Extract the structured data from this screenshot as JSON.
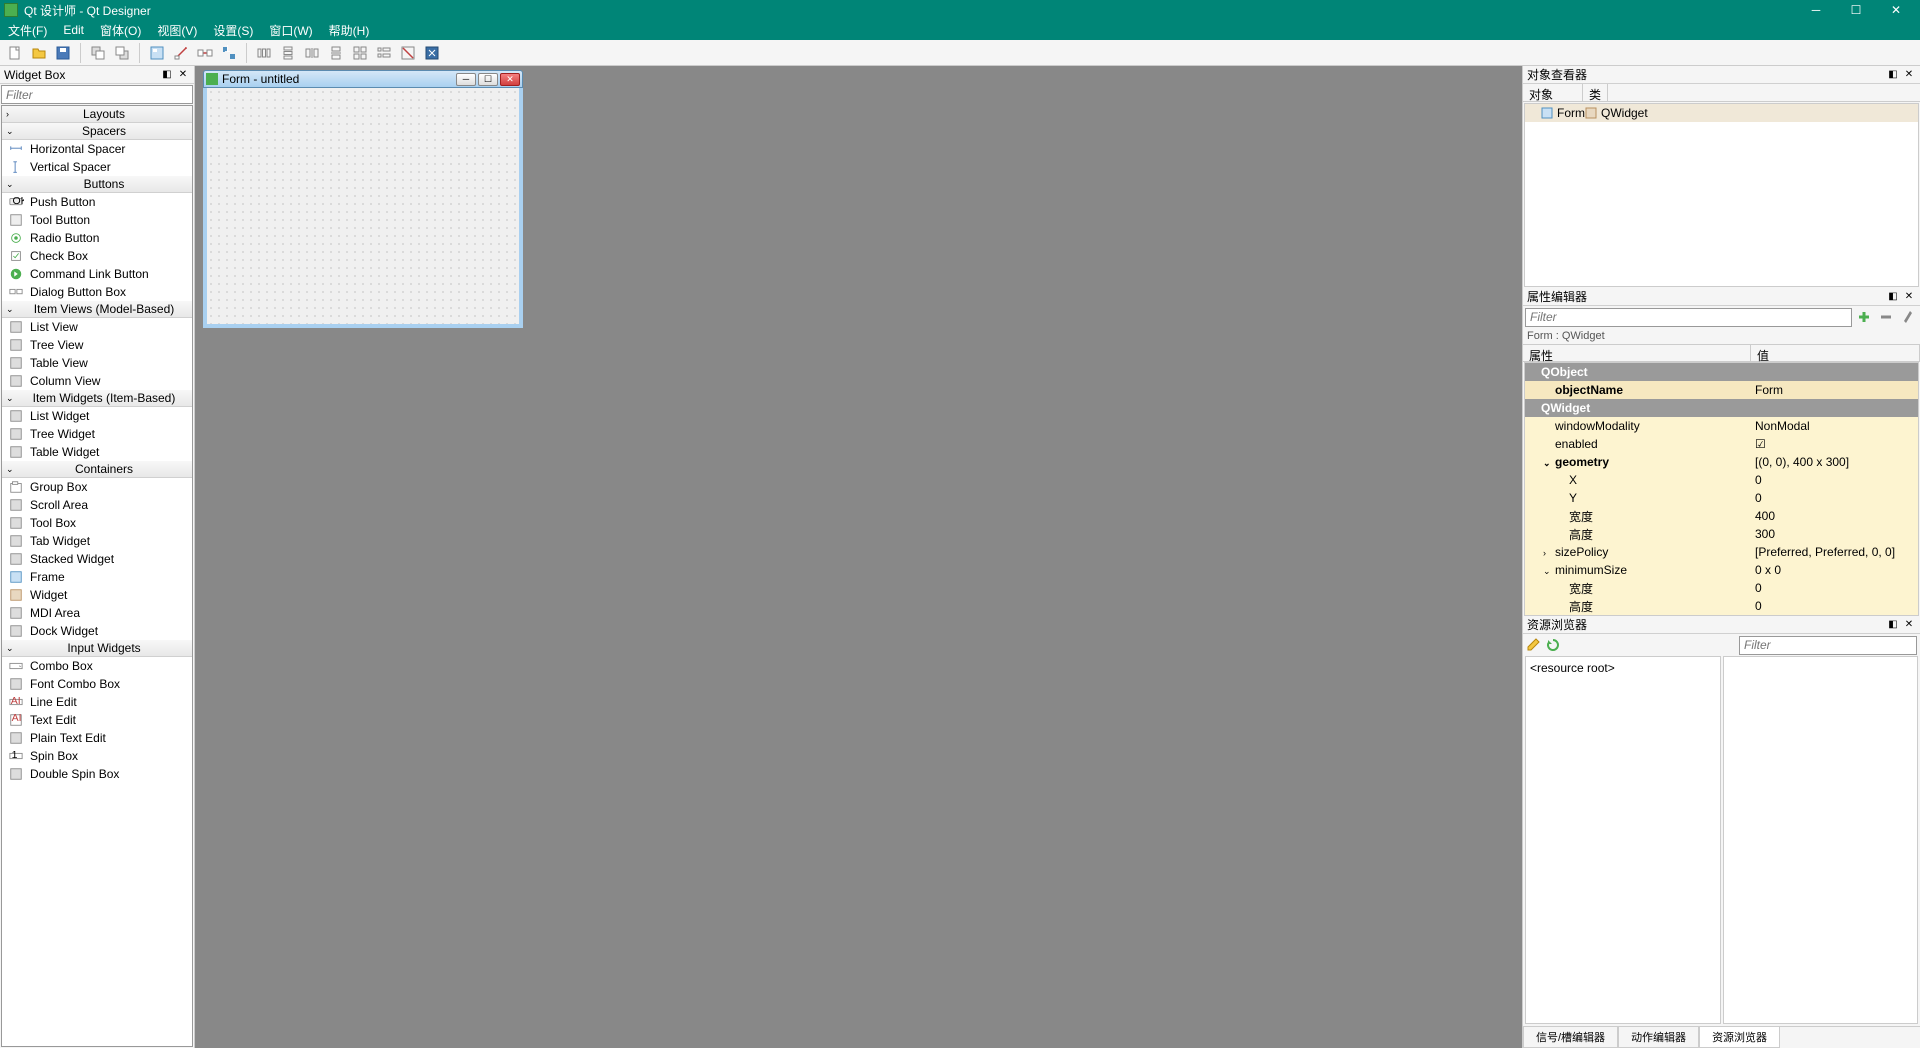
{
  "app": {
    "title": "Qt 设计师 - Qt Designer"
  },
  "menus": [
    "文件(F)",
    "Edit",
    "窗体(O)",
    "视图(V)",
    "设置(S)",
    "窗口(W)",
    "帮助(H)"
  ],
  "dock_left": {
    "title": "Widget Box",
    "filter_placeholder": "Filter"
  },
  "categories": [
    {
      "name": "Layouts",
      "open": false,
      "items": []
    },
    {
      "name": "Spacers",
      "open": true,
      "items": [
        "Horizontal Spacer",
        "Vertical Spacer"
      ]
    },
    {
      "name": "Buttons",
      "open": true,
      "items": [
        "Push Button",
        "Tool Button",
        "Radio Button",
        "Check Box",
        "Command Link Button",
        "Dialog Button Box"
      ]
    },
    {
      "name": "Item Views (Model-Based)",
      "open": true,
      "items": [
        "List View",
        "Tree View",
        "Table View",
        "Column View"
      ]
    },
    {
      "name": "Item Widgets (Item-Based)",
      "open": true,
      "items": [
        "List Widget",
        "Tree Widget",
        "Table Widget"
      ]
    },
    {
      "name": "Containers",
      "open": true,
      "items": [
        "Group Box",
        "Scroll Area",
        "Tool Box",
        "Tab Widget",
        "Stacked Widget",
        "Frame",
        "Widget",
        "MDI Area",
        "Dock Widget"
      ]
    },
    {
      "name": "Input Widgets",
      "open": true,
      "items": [
        "Combo Box",
        "Font Combo Box",
        "Line Edit",
        "Text Edit",
        "Plain Text Edit",
        "Spin Box",
        "Double Spin Box"
      ]
    }
  ],
  "form": {
    "title": "Form - untitled"
  },
  "inspector": {
    "title": "对象查看器",
    "col1": "对象",
    "col2": "类",
    "row_obj": "Form",
    "row_cls": "QWidget"
  },
  "prop": {
    "title": "属性编辑器",
    "filter_placeholder": "Filter",
    "form_label": "Form : QWidget",
    "col1": "属性",
    "col2": "值",
    "rows": [
      {
        "type": "group",
        "name": "QObject"
      },
      {
        "type": "hl bold",
        "name": "objectName",
        "val": "Form"
      },
      {
        "type": "group",
        "name": "QWidget"
      },
      {
        "type": "ylw",
        "name": "windowModality",
        "val": "NonModal"
      },
      {
        "type": "ylw",
        "name": "enabled",
        "val": "☑"
      },
      {
        "type": "ylw bold",
        "name": "geometry",
        "val": "[(0, 0), 400 x 300]",
        "exp": "v"
      },
      {
        "type": "ylw indent",
        "name": "X",
        "val": "0"
      },
      {
        "type": "ylw indent",
        "name": "Y",
        "val": "0"
      },
      {
        "type": "ylw indent",
        "name": "宽度",
        "val": "400"
      },
      {
        "type": "ylw indent",
        "name": "高度",
        "val": "300"
      },
      {
        "type": "ylw",
        "name": "sizePolicy",
        "val": "[Preferred, Preferred, 0, 0]",
        "exp": ">"
      },
      {
        "type": "ylw",
        "name": "minimumSize",
        "val": "0 x 0",
        "exp": "v"
      },
      {
        "type": "ylw indent",
        "name": "宽度",
        "val": "0"
      },
      {
        "type": "ylw indent",
        "name": "高度",
        "val": "0"
      }
    ]
  },
  "res": {
    "title": "资源浏览器",
    "filter_placeholder": "Filter",
    "root": "<resource root>",
    "tabs": [
      "信号/槽编辑器",
      "动作编辑器",
      "资源浏览器"
    ]
  }
}
